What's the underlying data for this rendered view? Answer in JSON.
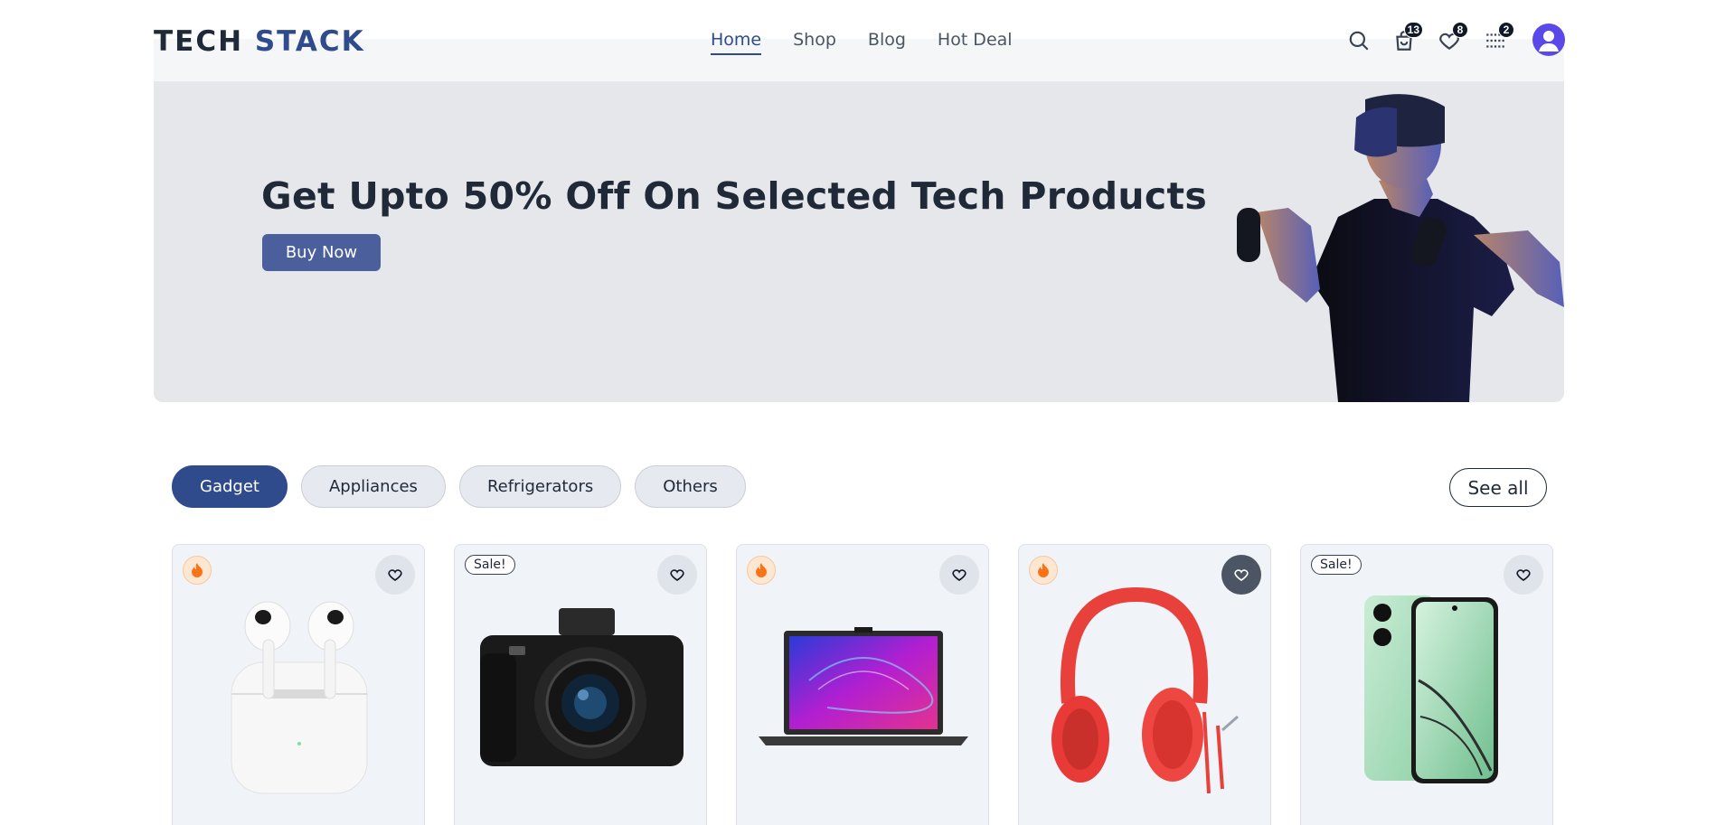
{
  "brand": {
    "part1": "TECH",
    "part2": "STACK"
  },
  "nav": {
    "items": [
      {
        "label": "Home",
        "active": true
      },
      {
        "label": "Shop",
        "active": false
      },
      {
        "label": "Blog",
        "active": false
      },
      {
        "label": "Hot Deal",
        "active": false
      }
    ]
  },
  "header_icons": {
    "search": "search-icon",
    "cart": {
      "icon": "shopping-bag-icon",
      "count": "13"
    },
    "wishlist": {
      "icon": "heart-icon",
      "count": "8"
    },
    "compare": {
      "icon": "grid-list-icon",
      "count": "2"
    },
    "account": "user-avatar-icon"
  },
  "hero": {
    "title": "Get Upto 50% Off On Selected Tech Products",
    "cta": "Buy Now",
    "image": "vr-headset-man-image"
  },
  "categories": {
    "tabs": [
      {
        "label": "Gadget",
        "active": true
      },
      {
        "label": "Appliances",
        "active": false
      },
      {
        "label": "Refrigerators",
        "active": false
      },
      {
        "label": "Others",
        "active": false
      }
    ],
    "see_all": "See all"
  },
  "products": [
    {
      "image": "airpods-image",
      "badge_type": "hot",
      "wishlisted": false
    },
    {
      "image": "canon-camera-image",
      "badge_type": "sale",
      "badge_label": "Sale!",
      "wishlisted": false
    },
    {
      "image": "laptop-image",
      "badge_type": "hot",
      "wishlisted": false
    },
    {
      "image": "red-headphones-image",
      "badge_type": "hot",
      "wishlisted": true
    },
    {
      "image": "green-smartphone-image",
      "badge_type": "sale",
      "badge_label": "Sale!",
      "wishlisted": false
    }
  ],
  "colors": {
    "brand_blue": "#2f4b8c",
    "button_blue": "#4a5f9c",
    "hero_bg": "#e5e7eb",
    "card_bg": "#f0f3f7",
    "avatar": "#5b48e8",
    "fire": "#f97316"
  }
}
